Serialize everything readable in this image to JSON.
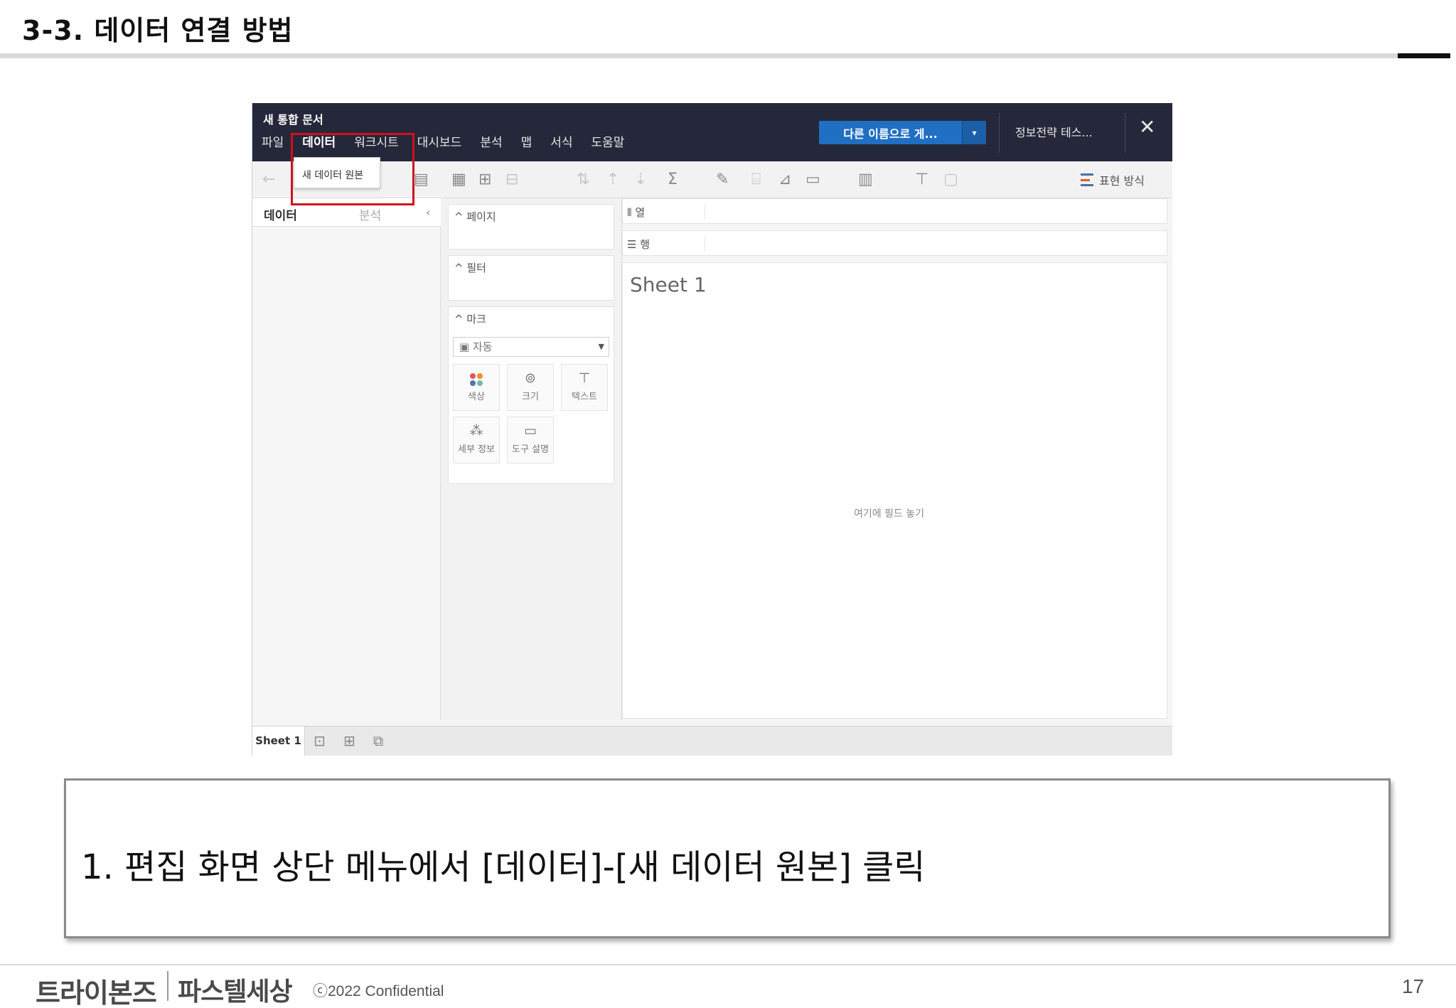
{
  "slide": {
    "title": "3-3. 데이터 연결 방법",
    "instruction": "1.  편집 화면 상단 메뉴에서 [데이터]-[새 데이터 원본] 클릭",
    "footer": {
      "logo_primary": "트라이본즈",
      "logo_secondary": "파스텔세상",
      "copyright": "ⓒ2022 Confidential",
      "page_number": "17"
    }
  },
  "tableau": {
    "document_title": "새 통합 문서",
    "menu": [
      "파일",
      "데이터",
      "워크시트",
      "대시보드",
      "분석",
      "맵",
      "서식",
      "도움말"
    ],
    "active_menu": "데이터",
    "save_button": "다른 이름으로 게...",
    "save_dropdown_icon": "▾",
    "account": "정보전략 테스...",
    "close_icon": "✕",
    "dropdown_item": "새 데이터 원본",
    "toolbar_format": "표현 방식",
    "data_pane": {
      "tab_data": "데이터",
      "tab_analysis": "분석",
      "collapse": "‹"
    },
    "cards": {
      "pages": "^ 페이지",
      "filters": "^ 필터",
      "marks": "^ 마크",
      "mark_type": "자동",
      "mark_buttons": [
        {
          "label": "색상",
          "icon": "color-dots-icon"
        },
        {
          "label": "크기",
          "icon": "size-icon"
        },
        {
          "label": "텍스트",
          "icon": "text-icon"
        },
        {
          "label": "세부 정보",
          "icon": "detail-icon"
        },
        {
          "label": "도구 설명",
          "icon": "tooltip-icon"
        }
      ]
    },
    "shelves": {
      "columns": "열",
      "rows": "행"
    },
    "sheet_title": "Sheet 1",
    "drop_hint": "여기에 필드 놓기",
    "sheet_tab": "Sheet 1"
  },
  "colors": {
    "topbar": "#25283a",
    "save_button": "#1f6fc3",
    "highlight_box": "#d0101c"
  }
}
